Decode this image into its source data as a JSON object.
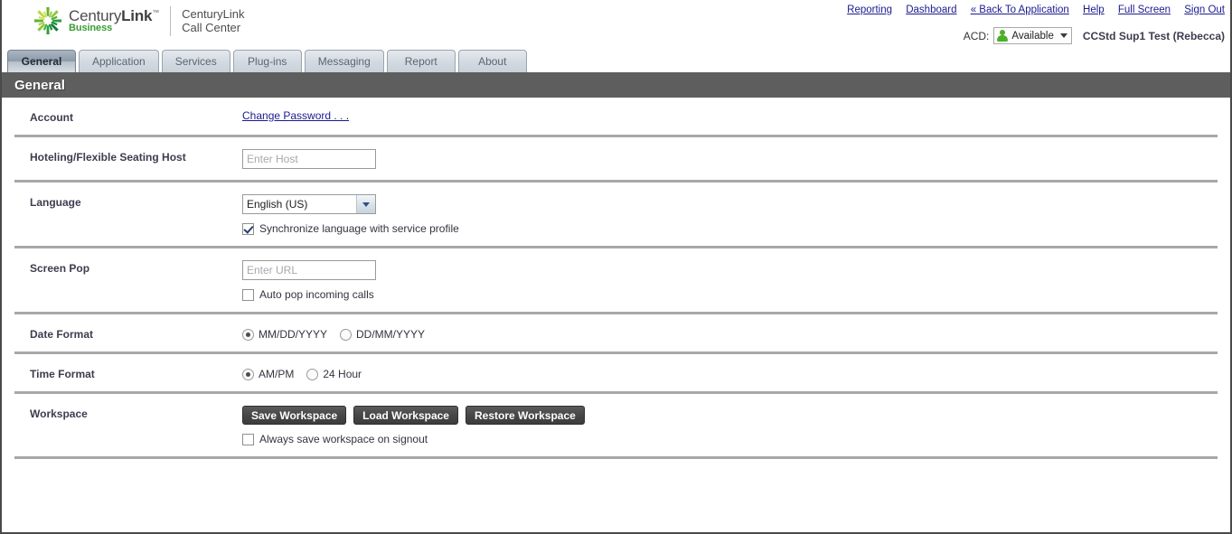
{
  "brand": {
    "name_part1": "Century",
    "name_part2": "Link",
    "trademark": "™",
    "sub": "Business",
    "product_line1": "CenturyLink",
    "product_line2": "Call Center",
    "logo_icon": "sunburst-logo-icon"
  },
  "toplinks": [
    {
      "label": "Reporting",
      "name": "reporting-link"
    },
    {
      "label": "Dashboard",
      "name": "dashboard-link"
    },
    {
      "label": "« Back To Application",
      "name": "back-to-application-link"
    },
    {
      "label": "Help",
      "name": "help-link"
    },
    {
      "label": "Full Screen",
      "name": "full-screen-link"
    },
    {
      "label": "Sign Out",
      "name": "sign-out-link"
    }
  ],
  "acd": {
    "label": "ACD:",
    "status": "Available",
    "status_icon": "person-available-icon",
    "caret_icon": "chevron-down-icon",
    "status_color": "#4caf28"
  },
  "user": {
    "display_name": "CCStd Sup1 Test (Rebecca)"
  },
  "tabs": [
    {
      "label": "General",
      "active": true
    },
    {
      "label": "Application",
      "active": false
    },
    {
      "label": "Services",
      "active": false
    },
    {
      "label": "Plug-ins",
      "active": false
    },
    {
      "label": "Messaging",
      "active": false
    },
    {
      "label": "Report",
      "active": false
    },
    {
      "label": "About",
      "active": false
    }
  ],
  "page": {
    "title": "General",
    "titlebar_color": "#5e5e5e"
  },
  "settings": {
    "account": {
      "label": "Account",
      "change_password_link": "Change Password . . ."
    },
    "hoteling": {
      "label": "Hoteling/Flexible Seating Host",
      "host_value": "",
      "host_placeholder": "Enter Host"
    },
    "language": {
      "label": "Language",
      "selected": "English (US)",
      "dropdown_icon": "chevron-down-icon",
      "sync_checkbox_label": "Synchronize language with service profile",
      "sync_checked": true
    },
    "screen_pop": {
      "label": "Screen Pop",
      "url_value": "",
      "url_placeholder": "Enter URL",
      "auto_pop_label": "Auto pop incoming calls",
      "auto_pop_checked": false
    },
    "date_format": {
      "label": "Date Format",
      "options": [
        {
          "label": "MM/DD/YYYY",
          "selected": true
        },
        {
          "label": "DD/MM/YYYY",
          "selected": false
        }
      ]
    },
    "time_format": {
      "label": "Time Format",
      "options": [
        {
          "label": "AM/PM",
          "selected": true
        },
        {
          "label": "24 Hour",
          "selected": false
        }
      ]
    },
    "workspace": {
      "label": "Workspace",
      "buttons": [
        {
          "label": "Save Workspace"
        },
        {
          "label": "Load Workspace"
        },
        {
          "label": "Restore Workspace"
        }
      ],
      "always_save_label": "Always save workspace on signout",
      "always_save_checked": false
    }
  }
}
